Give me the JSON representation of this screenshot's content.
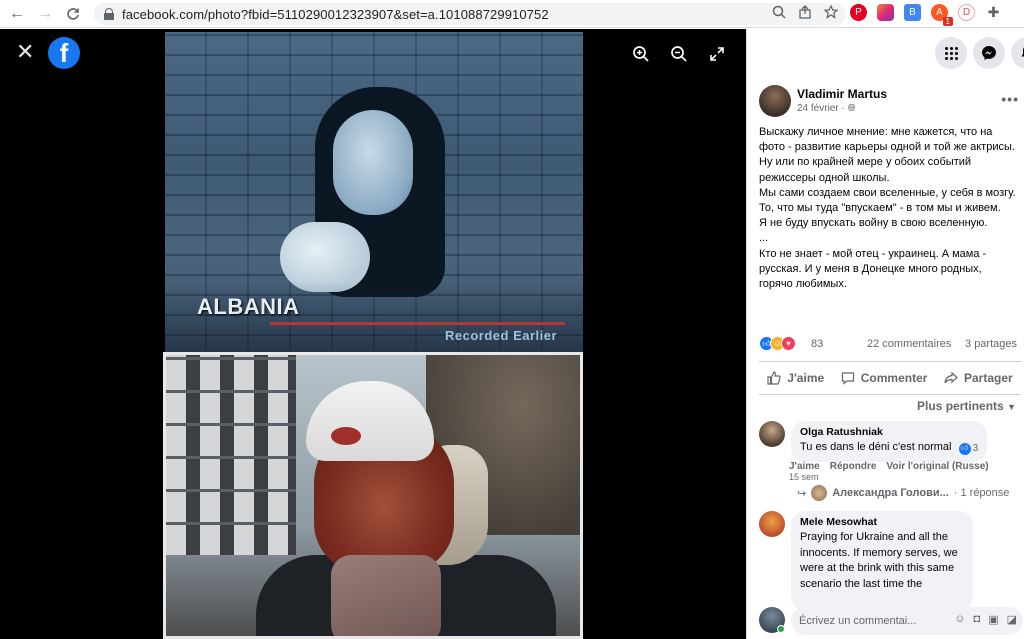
{
  "browser": {
    "url": "facebook.com/photo?fbid=5110290012323907&set=a.101088729910752",
    "back": "←",
    "forward": "→",
    "reload": "C",
    "ext_badge": "1"
  },
  "viewer": {
    "close": "✕",
    "fb_letter": "f",
    "zoom_in": "⊕",
    "zoom_out": "⊖",
    "expand": "⤢",
    "top_photo": {
      "caption": "ALBANIA",
      "subcaption": "Recorded Earlier"
    }
  },
  "post": {
    "author": "Vladimir Martus",
    "date": "24 février · ",
    "more": "•••",
    "text": "Выскажу личное мнение: мне кажется, что на фото - развитие карьеры одной и той же актрисы. Ну или по крайней мере у обоих событий режиссеры одной школы.\nМы сами создаем свои вселенные, у себя в мозгу. То, что мы туда \"впускаем\" - в том мы и живем.\nЯ не буду впускать войну в свою вселенную.\n...\nКто не знает - мой отец - украинец. А мама - русская. И у меня в Донецке много родных, горячо любимых.",
    "reaction_count": "83",
    "comment_count": "22 commentaires",
    "share_count": "3 partages",
    "actions": {
      "like": "J'aime",
      "comment": "Commenter",
      "share": "Partager"
    },
    "sort_label": "Plus pertinents"
  },
  "comments": [
    {
      "name": "Olga Ratushniak",
      "text": "Tu es dans le déni c'est normal",
      "likes": "3",
      "actions": [
        "J'aime",
        "Répondre",
        "Voir l'original (Russe)"
      ],
      "time": "15 sem"
    },
    {
      "name": "Mele Mesowhat",
      "text": "Praying for Ukraine and all the innocents. If memory serves, we were at the brink with this same scenario the last time the"
    }
  ],
  "reply": {
    "name": "Александра Голови...",
    "count": "· 1 réponse"
  },
  "compose": {
    "placeholder": "Écrivez un commentai..."
  },
  "colors": {
    "fb_blue": "#1877f2",
    "viewer_bg": "#000000"
  }
}
